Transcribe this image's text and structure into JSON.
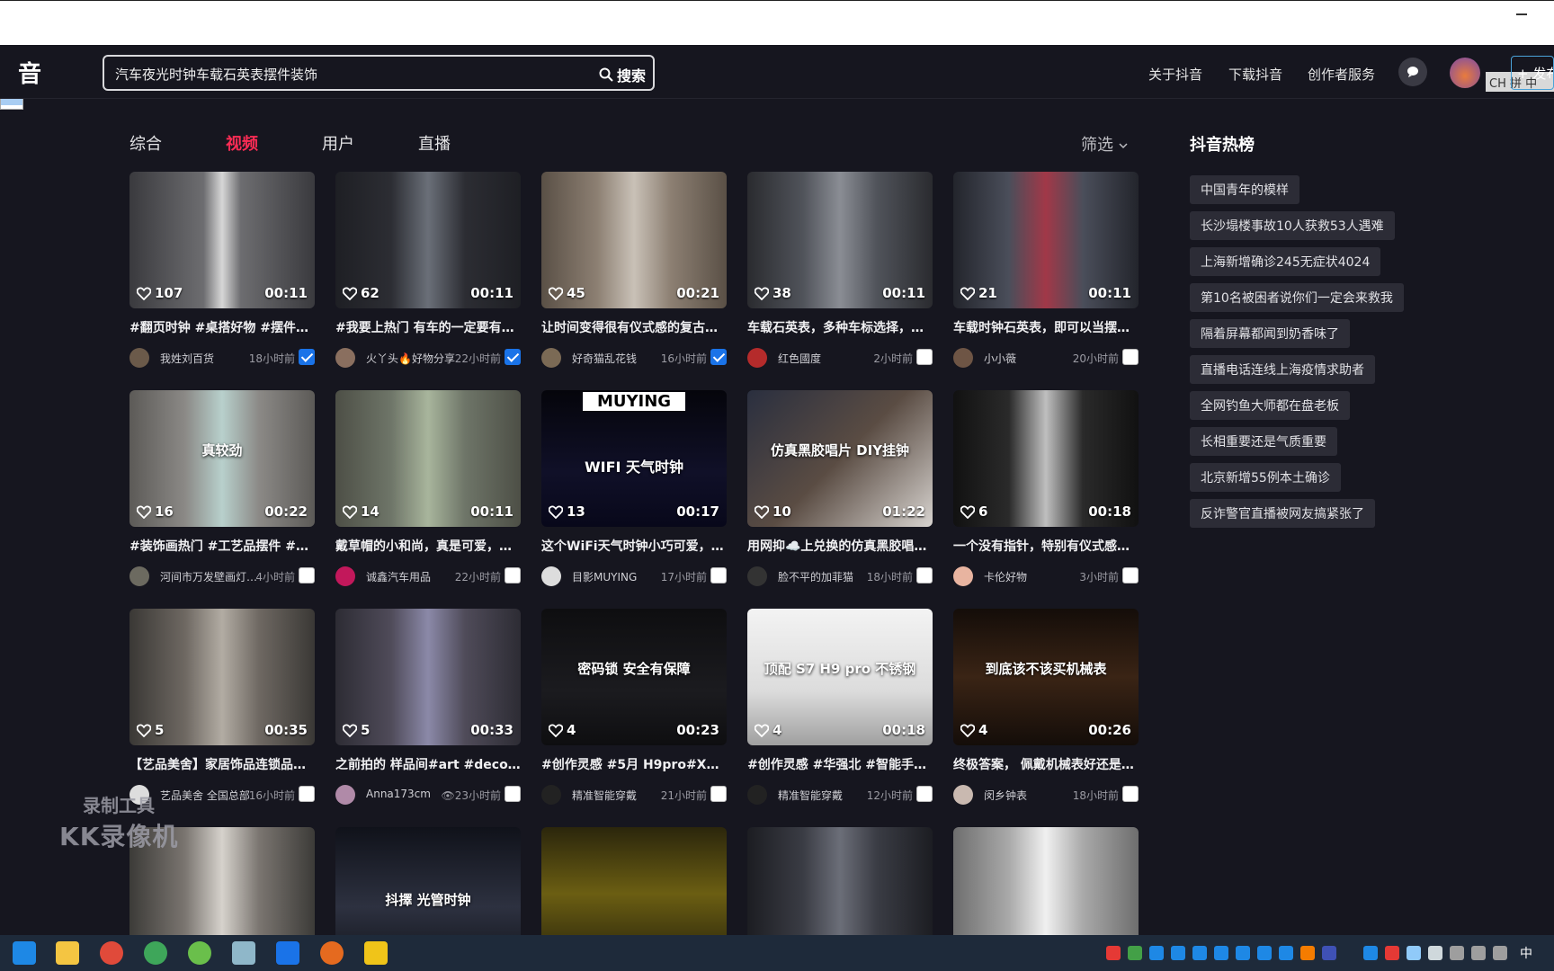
{
  "search": {
    "query": "汽车夜光时钟车载石英表摆件装饰",
    "button_label": "搜索"
  },
  "header": {
    "logo_text": "音",
    "nav": [
      "关于抖音",
      "下载抖音",
      "创作者服务"
    ],
    "ime_text": "CH 拼 中",
    "publish_label": "+ 发布"
  },
  "tabs": [
    {
      "label": "综合",
      "active": false
    },
    {
      "label": "视频",
      "active": true
    },
    {
      "label": "用户",
      "active": false
    },
    {
      "label": "直播",
      "active": false
    }
  ],
  "filter_label": "筛选",
  "videos": [
    {
      "likes": "107",
      "duration": "00:11",
      "title": "#翻页时钟 #桌搭好物 #摆件#…",
      "author": "我姓刘百货",
      "time": "18小时前",
      "checked": true
    },
    {
      "likes": "62",
      "duration": "00:11",
      "title": "#我要上热门 有车的一定要有…",
      "author": "火丫头🔥好物分享",
      "time": "22小时前",
      "checked": true
    },
    {
      "likes": "45",
      "duration": "00:21",
      "title": "让时间变得很有仪式感的复古…",
      "author": "好奇猫乱花钱",
      "time": "16小时前",
      "checked": true
    },
    {
      "likes": "38",
      "duration": "00:11",
      "title": "车载石英表，多种车标选择，…",
      "author": "红色國度",
      "time": "2小时前",
      "checked": false
    },
    {
      "likes": "21",
      "duration": "00:11",
      "title": "车载时钟石英表，即可以当摆…",
      "author": "小小薇",
      "time": "20小时前",
      "checked": false
    },
    {
      "likes": "16",
      "duration": "00:22",
      "title": "#装饰画热门 #工艺品摆件 #苏…",
      "author": "河间市万发壁画灯…",
      "time": "4小时前",
      "checked": false,
      "overlay": "真较劲"
    },
    {
      "likes": "14",
      "duration": "00:11",
      "title": "戴草帽的小和尚，真是可爱，…",
      "author": "诚鑫汽车用品",
      "time": "22小时前",
      "checked": false
    },
    {
      "likes": "13",
      "duration": "00:17",
      "title": "这个WiFi天气时钟小巧可爱，…",
      "author": "目影MUYING",
      "time": "17小时前",
      "checked": false,
      "overlay": "MUYING",
      "overlay2": "WIFI 天气时钟"
    },
    {
      "likes": "10",
      "duration": "01:22",
      "title": "用网抑☁️上兑换的仿真黑胶唱…",
      "author": "脸不平的加菲猫",
      "time": "18小时前",
      "checked": false,
      "overlay": "仿真黑胶唱片 DIY挂钟"
    },
    {
      "likes": "6",
      "duration": "00:18",
      "title": "一个没有指针，特别有仪式感…",
      "author": "卡伦好物",
      "time": "3小时前",
      "checked": false
    },
    {
      "likes": "5",
      "duration": "00:35",
      "title": "【艺品美舍】家居饰品连锁品…",
      "author": "艺品美舍 全国总部",
      "time": "16小时前",
      "checked": false
    },
    {
      "likes": "5",
      "duration": "00:33",
      "title": "之前拍的 样品间#art #deco…",
      "author": "Anna173cm",
      "time": "👁23小时前",
      "checked": false
    },
    {
      "likes": "4",
      "duration": "00:23",
      "title": "#创作灵感 #5月 H9pro#X10s…",
      "author": "精准智能穿戴",
      "time": "21小时前",
      "checked": false,
      "overlay": "密码锁 安全有保障"
    },
    {
      "likes": "4",
      "duration": "00:18",
      "title": "#创作灵感 #华强北 #智能手表…",
      "author": "精准智能穿戴",
      "time": "12小时前",
      "checked": false,
      "overlay": "顶配 S7 H9 pro 不锈钢"
    },
    {
      "likes": "4",
      "duration": "00:26",
      "title": "终极答案， 佩戴机械表好还是…",
      "author": "闵乡钟表",
      "time": "18小时前",
      "checked": false,
      "overlay": "到底该不该买机械表"
    },
    {
      "overlay": ""
    },
    {
      "overlay": "抖擇 光管时钟"
    },
    {
      "overlay": ""
    },
    {
      "overlay": ""
    },
    {
      "overlay": ""
    }
  ],
  "hot": {
    "title": "抖音热榜",
    "items": [
      "中国青年的模样",
      "长沙塌楼事故10人获救53人遇难",
      "上海新增确诊245无症状4024",
      "第10名被困者说你们一定会来救我",
      "隔着屏幕都闻到奶香味了",
      "直播电话连线上海疫情求助者",
      "全网钓鱼大师都在盘老板",
      "长相重要还是气质重要",
      "北京新增55例本土确诊",
      "反诈警官直播被网友搞紧张了"
    ]
  },
  "watermark": {
    "line1": "录制工具",
    "line2": "KK录像机"
  },
  "taskbar": {
    "ime_label": "中"
  }
}
